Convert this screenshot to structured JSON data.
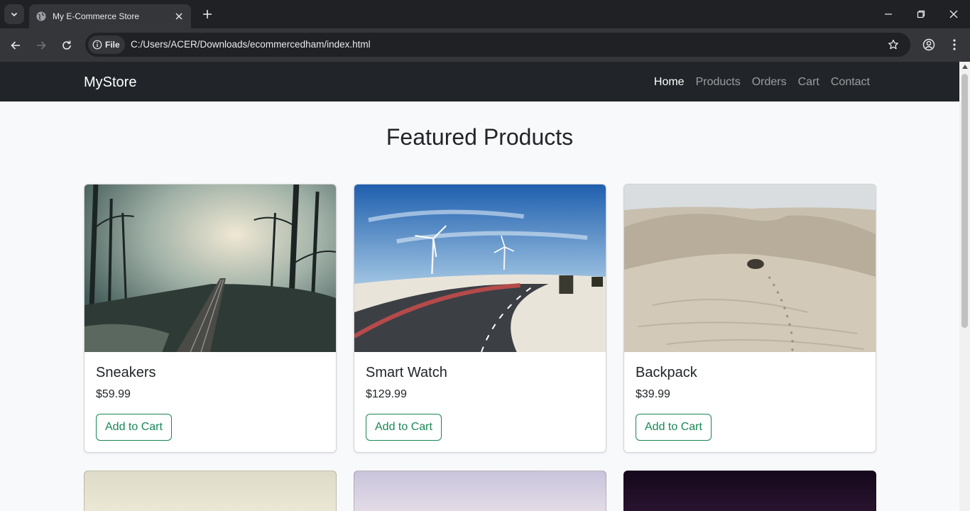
{
  "browser": {
    "tab_title": "My E-Commerce Store",
    "site_chip": "File",
    "url": "C:/Users/ACER/Downloads/ecommercedham/index.html"
  },
  "navbar": {
    "brand": "MyStore",
    "links": [
      {
        "label": "Home",
        "active": true
      },
      {
        "label": "Products",
        "active": false
      },
      {
        "label": "Orders",
        "active": false
      },
      {
        "label": "Cart",
        "active": false
      },
      {
        "label": "Contact",
        "active": false
      }
    ]
  },
  "main": {
    "heading": "Featured Products",
    "products": [
      {
        "name": "Sneakers",
        "price": "$59.99",
        "button": "Add to Cart",
        "image": "misty-forest-railway"
      },
      {
        "name": "Smart Watch",
        "price": "$129.99",
        "button": "Add to Cart",
        "image": "road-with-wind-turbines"
      },
      {
        "name": "Backpack",
        "price": "$39.99",
        "button": "Add to Cart",
        "image": "desert-dunes"
      }
    ]
  },
  "colors": {
    "navbar_bg": "#212529",
    "page_bg": "#f8f9fa",
    "button_accent": "#198754"
  }
}
